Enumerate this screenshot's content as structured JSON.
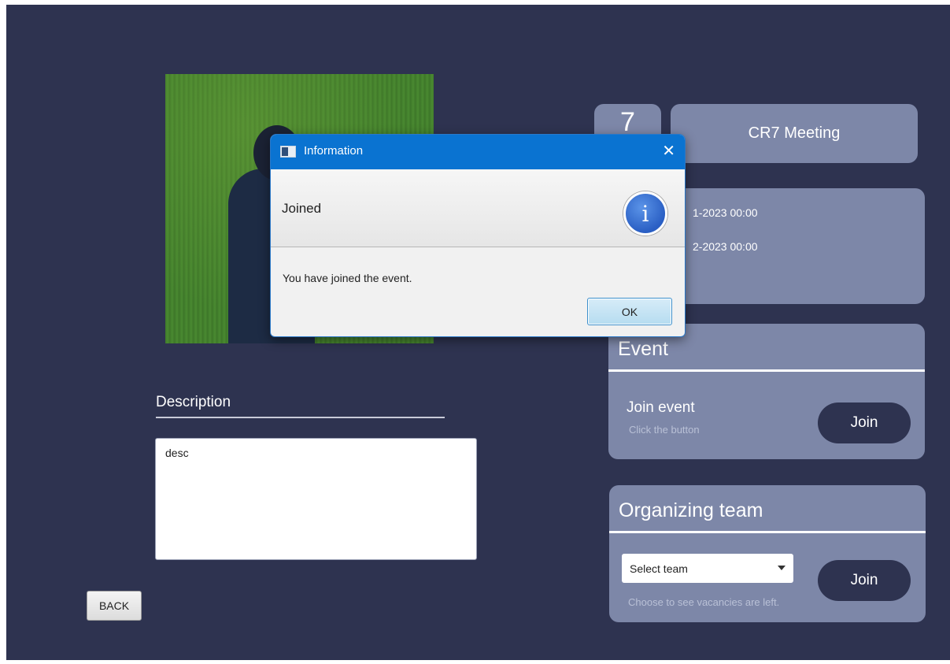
{
  "event": {
    "number": "7",
    "title": "CR7 Meeting",
    "date_start": "1-2023 00:00",
    "date_end": "2-2023 00:00"
  },
  "description": {
    "label": "Description",
    "value": "desc"
  },
  "back_button": "BACK",
  "event_section": {
    "title": "Event",
    "join_label": "Join event",
    "join_sub": "Click the button",
    "join_button": "Join"
  },
  "team_section": {
    "title": "Organizing team",
    "select_placeholder": "Select team",
    "sub": "Choose to see vacancies are left.",
    "join_button": "Join"
  },
  "dialog": {
    "title": "Information",
    "heading": "Joined",
    "content": "You have joined the event.",
    "ok_button": "OK",
    "close_glyph": "✕",
    "info_glyph": "i"
  },
  "colors": {
    "background": "#2e3350",
    "panel": "#7d87a8",
    "titlebar": "#0a73d1"
  },
  "icons": [
    "close-icon",
    "info-icon",
    "app-icon",
    "dropdown-arrow-icon"
  ]
}
